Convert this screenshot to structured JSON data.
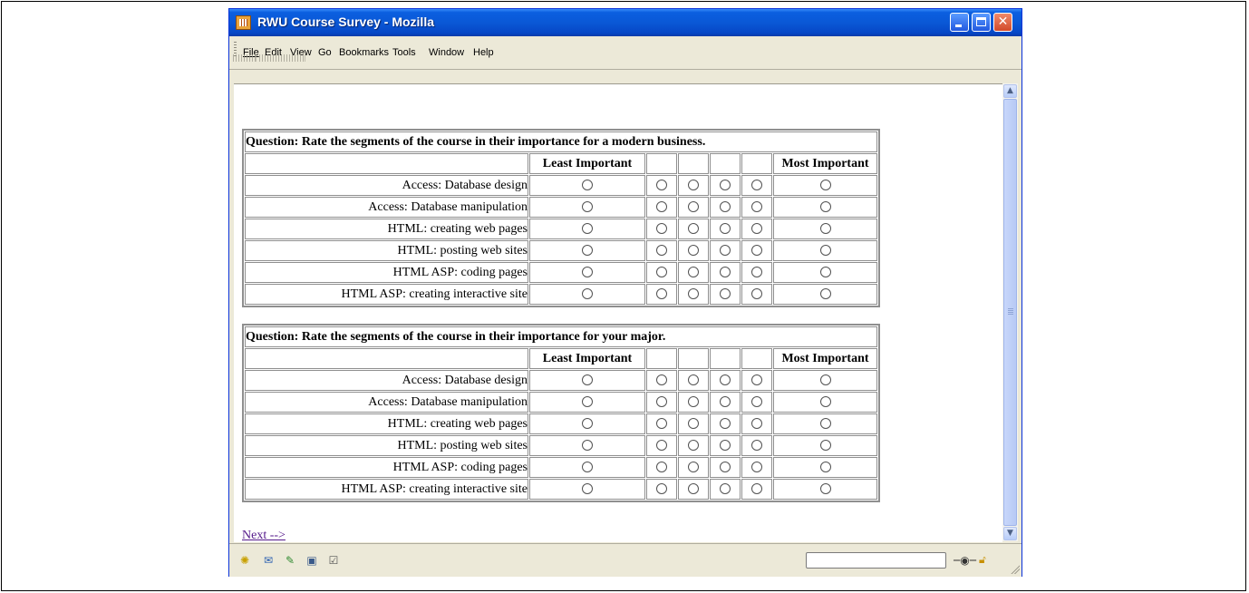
{
  "window": {
    "title": "RWU Course Survey - Mozilla"
  },
  "menu": [
    {
      "label": "File"
    },
    {
      "label": "Edit"
    },
    {
      "label": "View"
    },
    {
      "label": "Go"
    },
    {
      "label": "Bookmarks"
    },
    {
      "label": "Tools"
    },
    {
      "label": "Window"
    },
    {
      "label": "Help"
    }
  ],
  "surveys": [
    {
      "question": "Question:  Rate the segments of the course in their  importance for a modern business.",
      "least_label": "Least Important",
      "most_label": "Most Important",
      "rows": [
        "Access: Database design",
        "Access: Database manipulation",
        "HTML: creating web pages",
        "HTML: posting web sites",
        "HTML ASP: coding pages",
        "HTML ASP: creating interactive site"
      ]
    },
    {
      "question": "Question:  Rate the segments of the course in their  importance for your major.",
      "least_label": "Least Important",
      "most_label": "Most Important",
      "rows": [
        "Access: Database design",
        "Access: Database manipulation",
        "HTML: creating web pages",
        "HTML: posting web sites",
        "HTML ASP: coding pages",
        "HTML ASP: creating interactive site"
      ]
    }
  ],
  "next_link": "Next -->",
  "statusbar": {
    "icons": [
      "navigator-icon",
      "mail-icon",
      "composer-icon",
      "address-book-icon",
      "chatzilla-icon"
    ],
    "online_icon": "online-plug-icon",
    "security_icon": "unlocked-padlock-icon"
  }
}
